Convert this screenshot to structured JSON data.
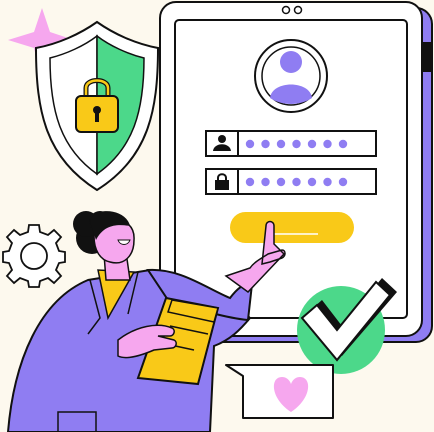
{
  "illustration": {
    "subject": "secure-login",
    "username_field": {
      "icon": "user-icon",
      "mask": "●●●●●●●",
      "mask_length": 7
    },
    "password_field": {
      "icon": "lock-icon",
      "mask": "●●●●●●●",
      "mask_length": 7
    },
    "icons": [
      "shield-lock-icon",
      "sparkle-icon",
      "gear-icon",
      "checkmark-icon",
      "heart-icon",
      "avatar-icon",
      "camera-dots-icon"
    ]
  },
  "colors": {
    "background": "#fdf9ee",
    "outline": "#111111",
    "purple": "#8f7df2",
    "green": "#4cd88a",
    "yellow": "#f9c918",
    "pink": "#f6a7ee",
    "white": "#ffffff"
  }
}
